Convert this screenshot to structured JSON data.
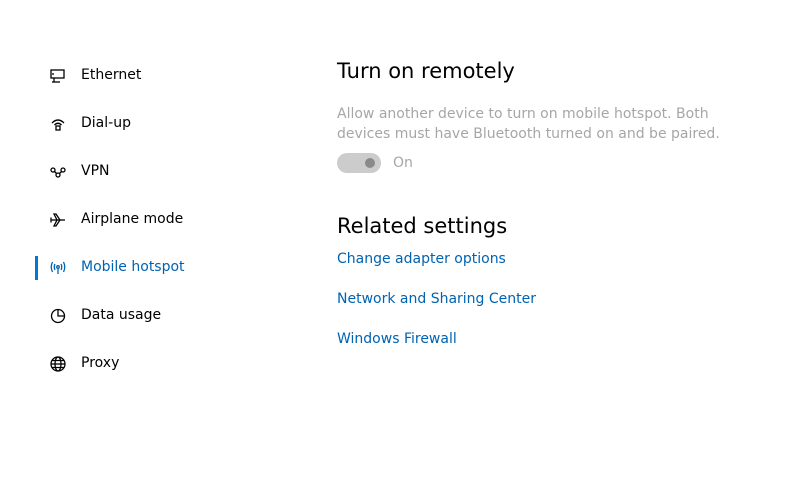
{
  "nav": {
    "items": [
      {
        "label": "Ethernet",
        "icon": "ethernet-icon",
        "selected": false
      },
      {
        "label": "Dial-up",
        "icon": "dialup-icon",
        "selected": false
      },
      {
        "label": "VPN",
        "icon": "vpn-icon",
        "selected": false
      },
      {
        "label": "Airplane mode",
        "icon": "airplane-icon",
        "selected": false
      },
      {
        "label": "Mobile hotspot",
        "icon": "hotspot-icon",
        "selected": true
      },
      {
        "label": "Data usage",
        "icon": "data-usage-icon",
        "selected": false
      },
      {
        "label": "Proxy",
        "icon": "globe-icon",
        "selected": false
      }
    ]
  },
  "turn_on_remotely": {
    "title": "Turn on remotely",
    "description": "Allow another device to turn on mobile hotspot. Both devices must have Bluetooth turned on and be paired.",
    "toggle_state": "On",
    "toggle_enabled": false
  },
  "related_settings": {
    "title": "Related settings",
    "links": [
      "Change adapter options",
      "Network and Sharing Center",
      "Windows Firewall"
    ]
  },
  "colors": {
    "accent": "#0078d7",
    "link": "#0063b1",
    "disabled_text": "#a6a6a6"
  }
}
